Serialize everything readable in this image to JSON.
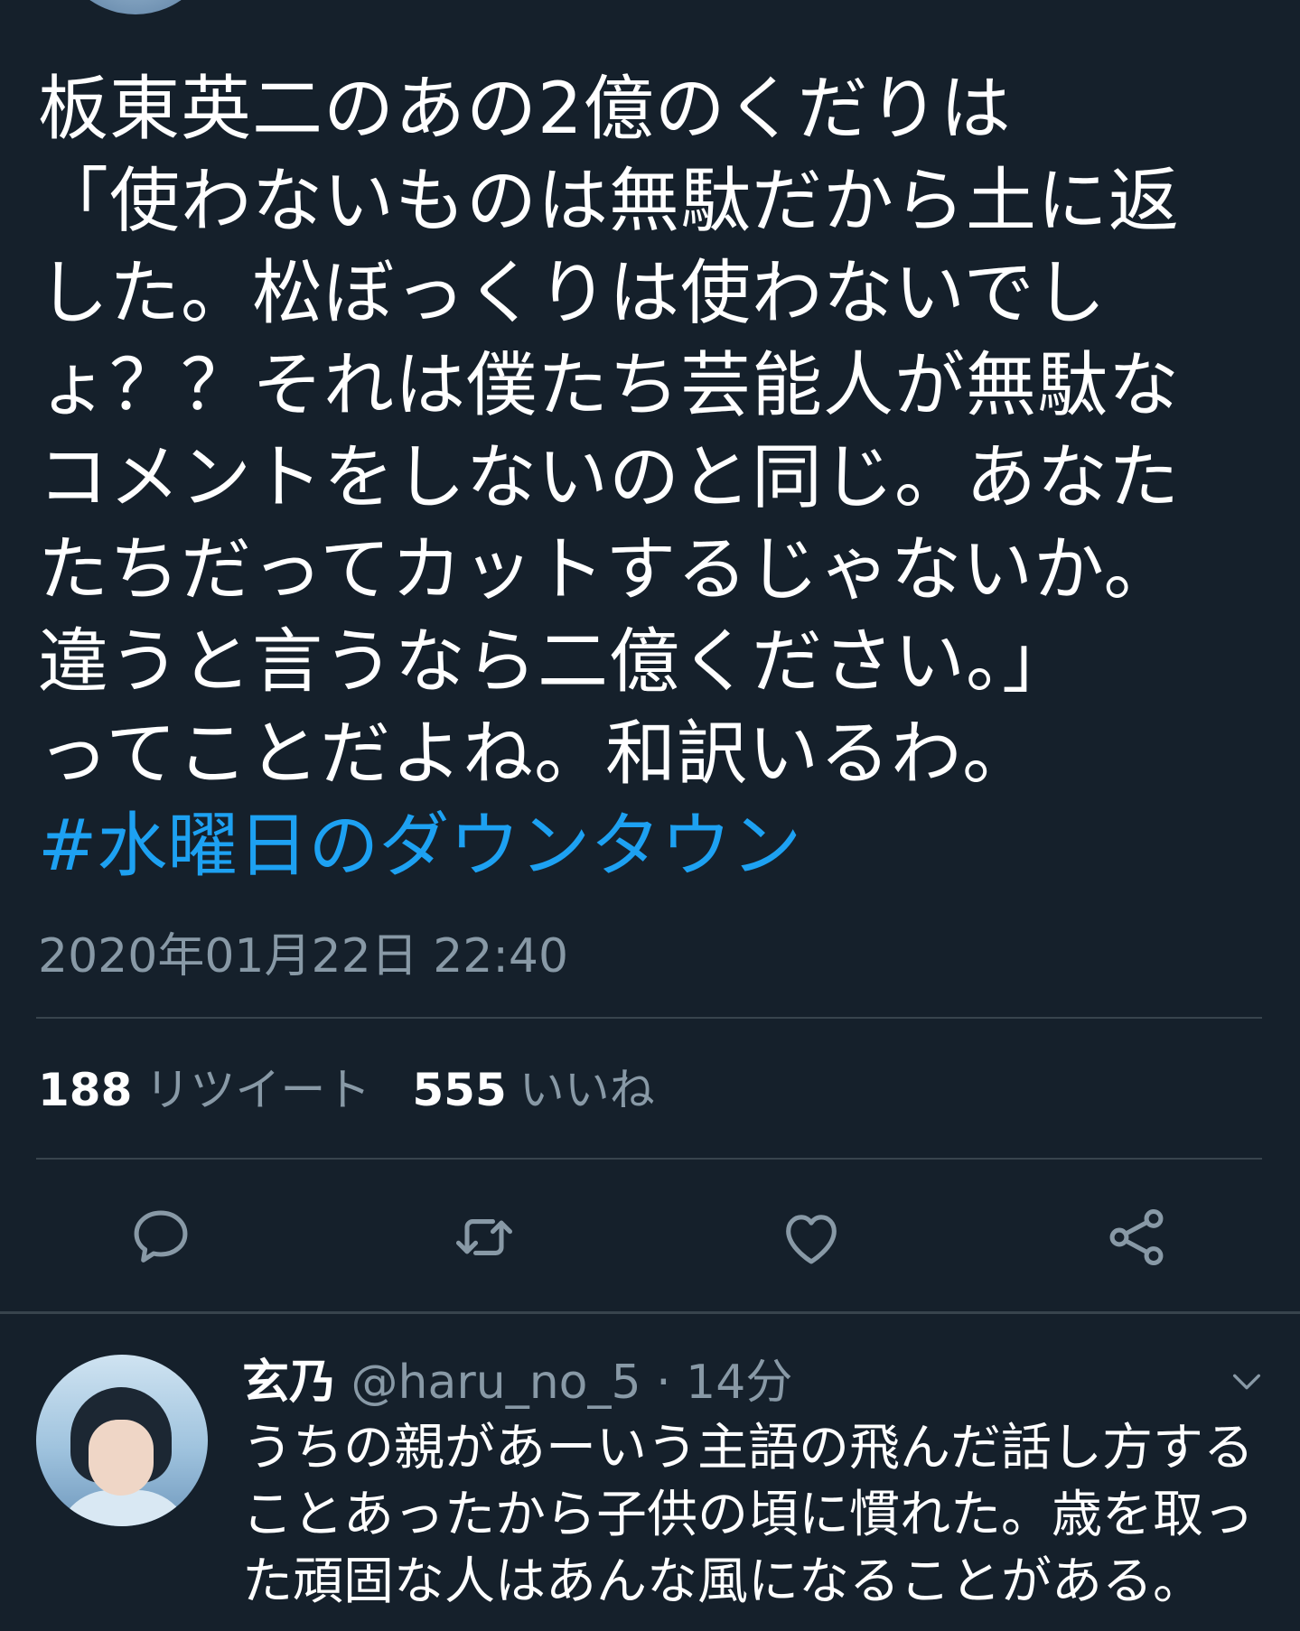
{
  "tweet": {
    "text": "板東英二のあの2億のくだりは\n「使わないものは無駄だから土に返\nした。松ぼっくりは使わないでし\nょ？？それは僕たち芸能人が無駄な\nコメントをしないのと同じ。あなた\nたちだってカットするじゃないか。\n違うと言うなら二億ください。」\nってことだよね。和訳いるわ。",
    "hashtag": "#水曜日のダウンタウン",
    "timestamp": "2020年01月22日 22:40",
    "retweet_count": "188",
    "retweet_label": "リツイート",
    "like_count": "555",
    "like_label": "いいね",
    "actions": [
      {
        "icon": "reply-icon"
      },
      {
        "icon": "retweet-icon"
      },
      {
        "icon": "heart-icon"
      },
      {
        "icon": "share-icon"
      }
    ]
  },
  "reply": {
    "name": "玄乃",
    "handle": "@haru_no_5",
    "separator": "·",
    "time": "14分",
    "text": "うちの親があーいう主語の飛んだ話し方する\nことあったから子供の頃に慣れた。歳を取っ\nた頑固な人はあんな風になることがある。"
  },
  "colors": {
    "background": "#15202b",
    "text": "#ffffff",
    "secondary": "#8899a6",
    "accent": "#1da1f2",
    "divider": "#38444d"
  }
}
